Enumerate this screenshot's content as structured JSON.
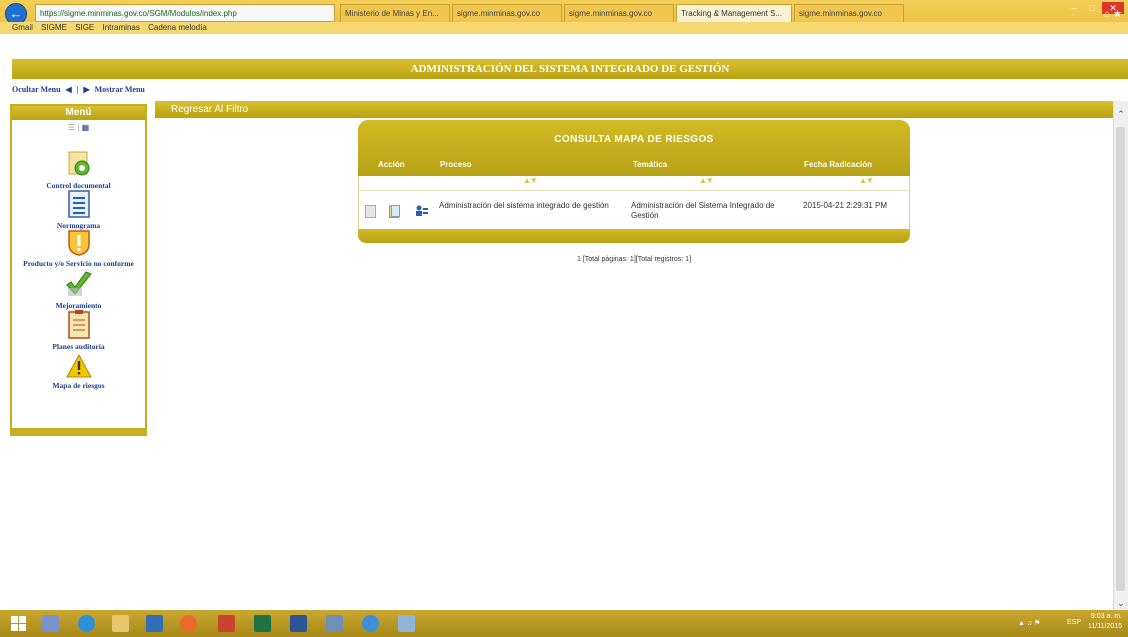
{
  "browser": {
    "address": "https://sigme.minminas.gov.co/SGM/Modulos/index.php",
    "tabs": [
      "Ministerio de Minas y En...",
      "sigme.minminas.gov.co",
      "sigme.minminas.gov.co",
      "Tracking & Management S...",
      "sigme.minminas.gov.co"
    ],
    "favorites": [
      "Gmail",
      "SIGME",
      "SIGE",
      "Intraminas",
      "Cadena melodía"
    ]
  },
  "app": {
    "header": "ADMINISTRACIÓN DEL SISTEMA INTEGRADO DE GESTIÓN",
    "hide_menu": "Ocultar Menu",
    "separator": "|",
    "show_menu": "Mostrar Menu"
  },
  "sidebar": {
    "title": "Menú",
    "items": [
      {
        "label": "Control documental"
      },
      {
        "label": "Normograma"
      },
      {
        "label": "Producto y/o Servicio no conforme"
      },
      {
        "label": "Mejoramiento"
      },
      {
        "label": "Planes auditoría"
      },
      {
        "label": "Mapa de riesgos"
      }
    ]
  },
  "main": {
    "back_link": "Regresar Al Filtro",
    "panel_title": "CONSULTA MAPA DE RIESGOS",
    "columns": [
      "Acción",
      "Proceso",
      "Temática",
      "Fecha Radicación"
    ],
    "rows": [
      {
        "proceso": "Administración del sistema integrado de gestión",
        "tematica": "Administración del Sistema Integrado de Gestión",
        "fecha": "2015-04-21 2:29:31 PM"
      }
    ],
    "pager_page": "1",
    "pager_text": "[Total páginas: 1][Total registros: 1]"
  },
  "taskbar": {
    "time": "9:03 a. m.",
    "date": "11/11/2015",
    "lang": "ESP"
  }
}
